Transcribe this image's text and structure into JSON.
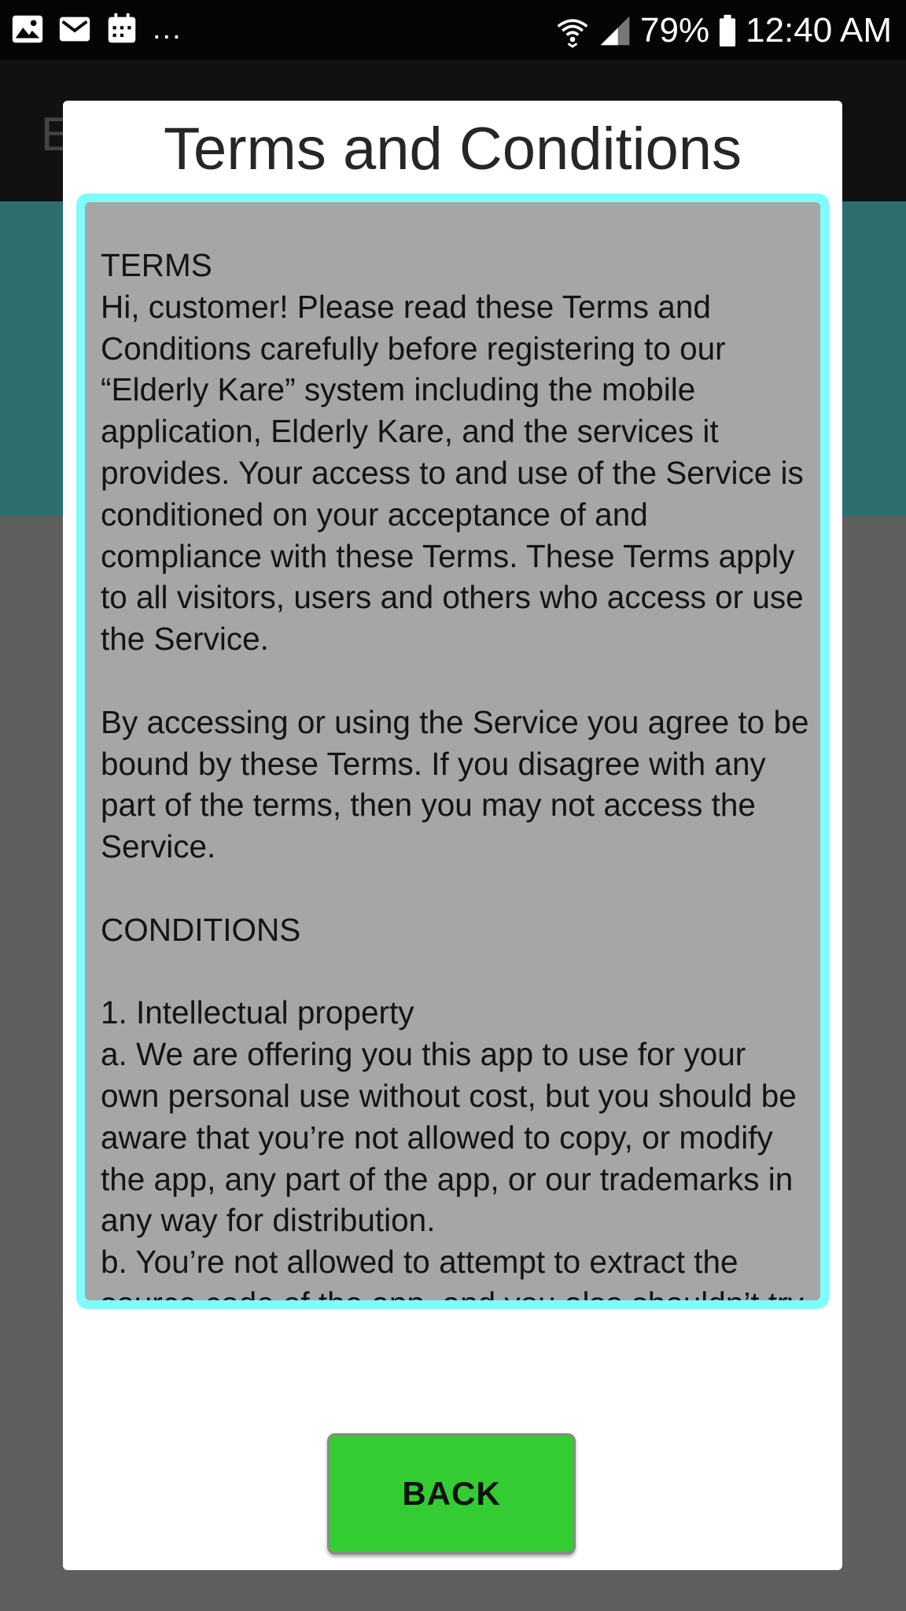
{
  "status_bar": {
    "icons_left": [
      "image-icon",
      "mail-icon",
      "calendar-icon"
    ],
    "more": "...",
    "icons_right": [
      "wifi-icon",
      "signal-icon",
      "battery-icon"
    ],
    "battery": "79%",
    "time": "12:40 AM"
  },
  "background_app": {
    "title_partial": "E"
  },
  "dialog": {
    "title": "Terms and Conditions",
    "terms_text": "TERMS\nHi, customer! Please read these Terms and Conditions carefully before registering to our “Elderly Kare” system including the mobile application, Elderly Kare, and the services it provides. Your access to and use of the Service is conditioned on your acceptance of and compliance with these Terms. These Terms apply to all visitors, users and others who access or use the Service.\n\nBy accessing or using the Service you agree to be bound by these Terms. If you disagree with any part of the terms, then you may not access the Service.\n\nCONDITIONS\n\n1. Intellectual property\na. We are offering you this app to use for your own personal use without cost, but you should be aware that you’re not allowed to copy, or modify the app, any part of the app, or our trademarks in any way for distribution.\nb. You’re not allowed to attempt to extract the source code of the app, and you also shouldn’t try to translate the app into other",
    "back_label": "BACK"
  },
  "colors": {
    "dialog_bg": "#ffffff",
    "terms_border": "#7ffcfc",
    "terms_bg": "#a6a6a6",
    "back_button": "#33cc33",
    "app_bar": "#111111",
    "app_teal": "#2e6e6e",
    "overlay": "#5f5f5f"
  }
}
